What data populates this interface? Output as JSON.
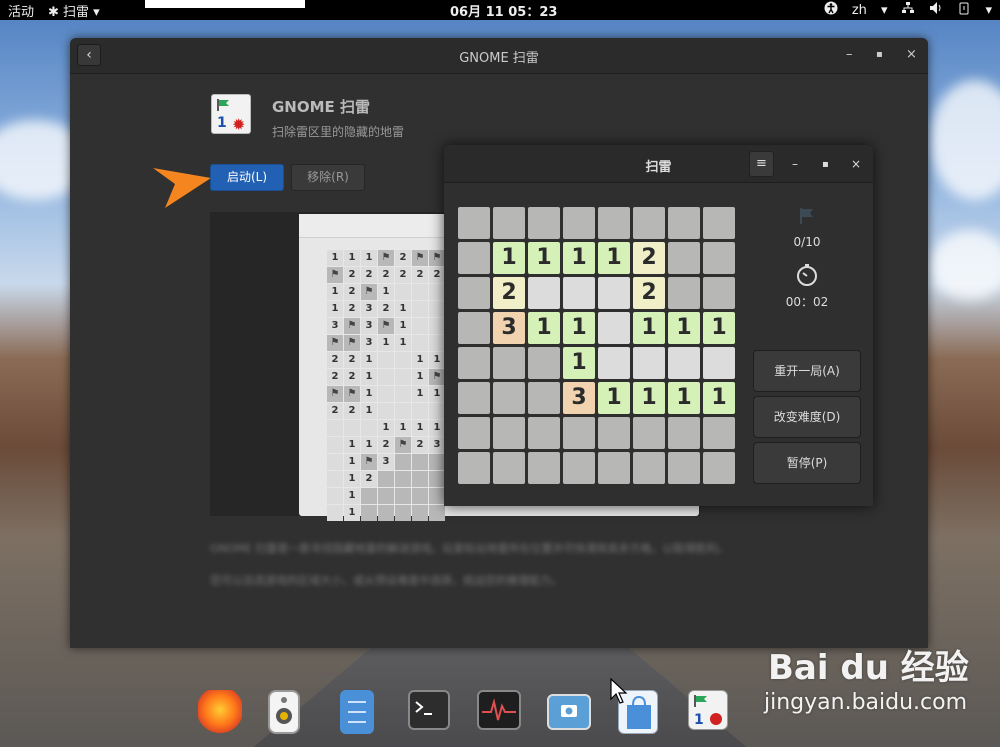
{
  "topbar": {
    "activities": "活动",
    "app_menu": "✱ 扫雷 ▾",
    "clock": "06月 11  05：23",
    "lang": "zh",
    "tray_icons": [
      "accessibility-icon",
      "network-icon",
      "volume-icon",
      "power-icon"
    ]
  },
  "software": {
    "window_title": "GNOME 扫雷",
    "app_name": "GNOME 扫雷",
    "app_summary": "扫除雷区里的隐藏的地雷",
    "launch_label": "启动(L)",
    "remove_label": "移除(R)",
    "description_1": "GNOME 扫雷是一款寻找隐藏地雷的解谜游戏。玩家标出地雷所在位置并尽快清除其余方格，以取得胜利。",
    "description_2": "您可以自选游戏的区域大小，或从预设难度中选择，挑战您的推理能力。",
    "mini_grid": [
      [
        "1",
        "1",
        "1",
        "F",
        "2",
        "F",
        "F"
      ],
      [
        "F",
        "2",
        "2",
        "2",
        "2",
        "2",
        "2"
      ],
      [
        "1",
        "2",
        "F",
        "1",
        "",
        "",
        ""
      ],
      [
        "1",
        "2",
        "3",
        "2",
        "1",
        "",
        ""
      ],
      [
        "3",
        "F",
        "3",
        "F",
        "1",
        "",
        ""
      ],
      [
        "F",
        "F",
        "3",
        "1",
        "1",
        "",
        ""
      ],
      [
        "2",
        "2",
        "1",
        "",
        "",
        "1",
        "1"
      ],
      [
        "2",
        "2",
        "1",
        "",
        "",
        "1",
        "F"
      ],
      [
        "F",
        "F",
        "1",
        "",
        "",
        "1",
        "1"
      ],
      [
        "2",
        "2",
        "1",
        "",
        "",
        "",
        ""
      ],
      [
        "",
        "",
        "",
        "1",
        "1",
        "1",
        "1"
      ],
      [
        "",
        "1",
        "1",
        "2",
        "F",
        "2",
        "3"
      ],
      [
        "",
        "1",
        "F",
        "3",
        "#",
        "#",
        "#"
      ],
      [
        "",
        "1",
        "2",
        "#",
        "#",
        "#",
        "#"
      ],
      [
        "",
        "1",
        "#",
        "#",
        "#",
        "#",
        "#"
      ],
      [
        "",
        "1",
        "#",
        "#",
        "#",
        "#",
        "#"
      ]
    ]
  },
  "minesweeper": {
    "title": "扫雷",
    "menu_label": "≡",
    "flags": "0/10",
    "time": "00：02",
    "new_game_label": "重开一局(A)",
    "change_difficulty_label": "改变难度(D)",
    "pause_label": "暂停(P)",
    "board": [
      [
        "#",
        "#",
        "#",
        "#",
        "#",
        "#",
        "#",
        "#"
      ],
      [
        "#",
        "1",
        "1",
        "1",
        "1",
        "2",
        "#",
        "#"
      ],
      [
        "#",
        "2",
        "",
        "",
        "",
        "2",
        "#",
        "#"
      ],
      [
        "#",
        "3",
        "1",
        "1",
        "",
        "1",
        "1",
        "1"
      ],
      [
        "#",
        "#",
        "#",
        "1",
        "",
        "",
        "",
        ""
      ],
      [
        "#",
        "#",
        "#",
        "3",
        "1",
        "1",
        "1",
        "1"
      ],
      [
        "#",
        "#",
        "#",
        "#",
        "#",
        "#",
        "#",
        "#"
      ],
      [
        "#",
        "#",
        "#",
        "#",
        "#",
        "#",
        "#",
        "#"
      ]
    ]
  },
  "dock": {
    "apps": [
      "firefox-icon",
      "rhythmbox-icon",
      "files-icon",
      "terminal-icon",
      "system-monitor-icon",
      "screenshot-icon",
      "software-icon",
      "mines-icon"
    ]
  },
  "watermark": {
    "brand": "Bai du 经验",
    "url": "jingyan.baidu.com"
  },
  "colors": {
    "accent": "#2160b3",
    "arrow": "#f5861f",
    "n1": "#d6f1b8",
    "n2": "#f0efc8",
    "n3": "#f1d3b0"
  }
}
